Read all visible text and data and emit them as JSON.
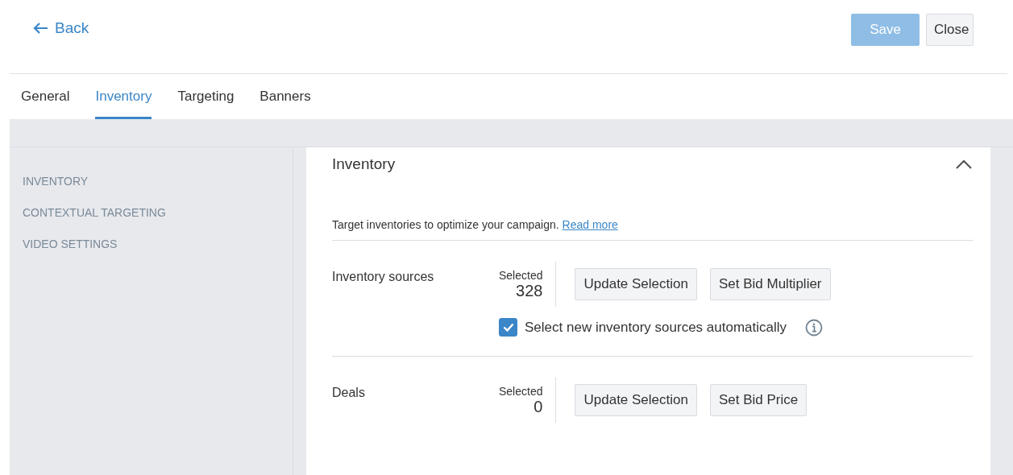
{
  "header": {
    "back": {
      "label": "Back"
    },
    "buttons": [
      {
        "label": "Save",
        "kind": "primary",
        "disabled": true
      },
      {
        "label": "Close",
        "kind": "secondary",
        "disabled": false
      }
    ]
  },
  "tabs": [
    {
      "label": "General",
      "selected": false
    },
    {
      "label": "Inventory",
      "selected": true
    },
    {
      "label": "Targeting",
      "selected": false
    },
    {
      "label": "Banners",
      "selected": false
    }
  ],
  "sidebar": {
    "items": [
      {
        "label": "INVENTORY"
      },
      {
        "label": "CONTEXTUAL TARGETING"
      },
      {
        "label": "VIDEO SETTINGS"
      }
    ]
  },
  "section": {
    "title": "Inventory",
    "expanded": true,
    "description": "Target inventories to optimize your campaign.",
    "link": "Read more",
    "rows": [
      {
        "label": "Inventory sources",
        "count_label": "Selected",
        "count": "328",
        "buttons": [
          "Update Selection",
          "Set Bid Multiplier"
        ],
        "option": {
          "label": "Select new inventory sources automatically",
          "checked": true
        }
      },
      {
        "label": "Deals",
        "count_label": "Selected",
        "count": "0",
        "buttons": [
          "Update Selection",
          "Set Bid Price"
        ]
      }
    ]
  }
}
